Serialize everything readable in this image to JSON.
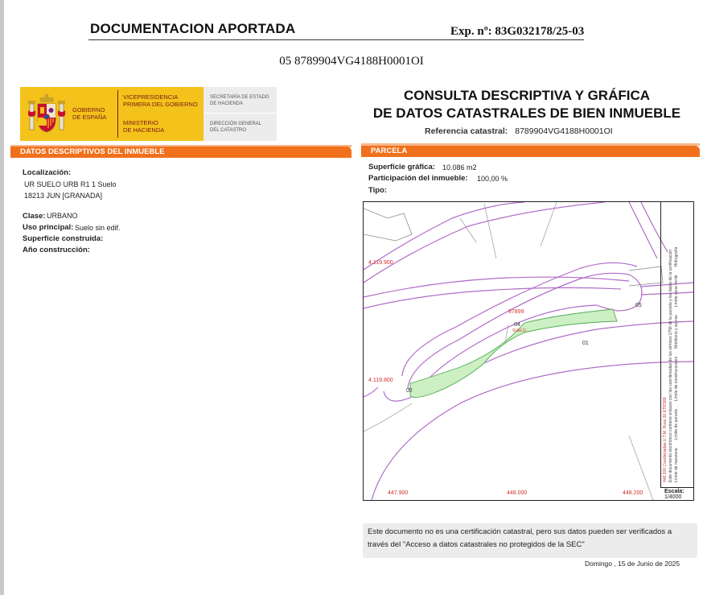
{
  "header": {
    "title": "DOCUMENTACION APORTADA",
    "exp": "Exp. nº: 83G032178/25-03",
    "reference_code": "05 8789904VG4188H0001OI"
  },
  "logo": {
    "gobierno": [
      "GOBIERNO",
      "DE ESPAÑA"
    ],
    "vicepresidencia": [
      "VICEPRESIDENCIA",
      "PRIMERA DEL GOBIERNO"
    ],
    "ministerio": [
      "MINISTERIO",
      "DE HACIENDA"
    ],
    "secretaria": [
      "SECRETARÍA DE ESTADO",
      "DE HACIENDA"
    ],
    "direccion": [
      "DIRECCIÓN GENERAL",
      "DEL CATASTRO"
    ]
  },
  "consulta": {
    "line1": "CONSULTA DESCRIPTIVA Y GRÁFICA",
    "line2": "DE DATOS CATASTRALES DE BIEN INMUEBLE",
    "ref_label": "Referencia catastral:",
    "ref_value": "8789904VG4188H0001OI"
  },
  "left_panel": {
    "title": "DATOS DESCRIPTIVOS DEL INMUEBLE",
    "localizacion_label": "Localización:",
    "localizacion_line1": "UR SUELO URB R1 1 Suelo",
    "localizacion_line2": "18213 JUN [GRANADA]",
    "clase_label": "Clase:",
    "clase_value": "URBANO",
    "uso_label": "Uso principal:",
    "uso_value": "Suelo sin edif.",
    "superficie_label": "Superficie construida:",
    "anio_label": "Año construcción:"
  },
  "right_panel": {
    "title": "PARCELA",
    "superficie_label": "Superficie gráfica:",
    "superficie_value": "10.086 m2",
    "participacion_label": "Participación del inmueble:",
    "participacion_value": "100,00 %",
    "tipo_label": "Tipo:"
  },
  "map": {
    "y_coords": [
      "4.119.900",
      "4.119.800"
    ],
    "x_coords": [
      "447.900",
      "448.000",
      "448.200"
    ],
    "parcel_labels": [
      "01",
      "02",
      "04",
      "05"
    ],
    "parcel_sub": "SUELO",
    "block_label": "87899",
    "legend_scale_label": "Escala:",
    "legend_scale_value": "1/4000",
    "side_text_1": "Este documento electrónico contiene enlaces con las coordenadas de los vértices UTM de la parcela y los datos de la certificación",
    "side_text_2": "448.200 Coordenadas U.T.M. Huso 30 ETRS89",
    "side_legend": [
      "Límite de manzana",
      "Límite de parcela",
      "Límite de construcciones",
      "Mobiliario y aceras",
      "Límite zona verde",
      "Hidrografía"
    ],
    "colors": {
      "parcel_fill": "#ccf0c4",
      "parcel_stroke": "#55aa55",
      "road_stroke": "#b06cc8",
      "coord_text": "#d0312d"
    }
  },
  "notice": "Este documento no es una certificación catastral, pero sus datos pueden ser verificados a través del \"Acceso a datos catastrales no protegidos de la SEC\"",
  "date": "Domingo , 15 de Junio de 2025",
  "colors": {
    "accent": "#f0701c",
    "logo_yellow": "#f3c21b"
  }
}
